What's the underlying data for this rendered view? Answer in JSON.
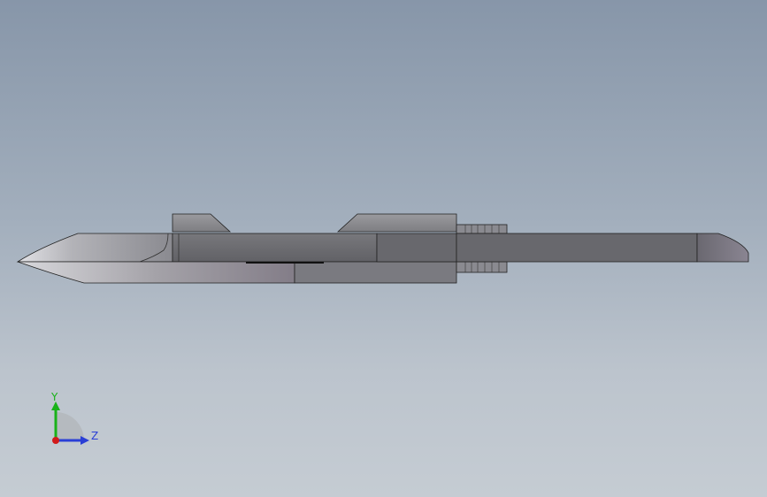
{
  "viewport": {
    "background_top": "#8796a9",
    "background_bottom": "#c5ccd3"
  },
  "model": {
    "part_color": "#6c6c70",
    "edge_color": "#1a1a1a"
  },
  "triad": {
    "y_label": "Y",
    "z_label": "Z",
    "y_color": "#19b219",
    "z_color": "#2a3fd6",
    "x_color": "#d11a1a"
  }
}
